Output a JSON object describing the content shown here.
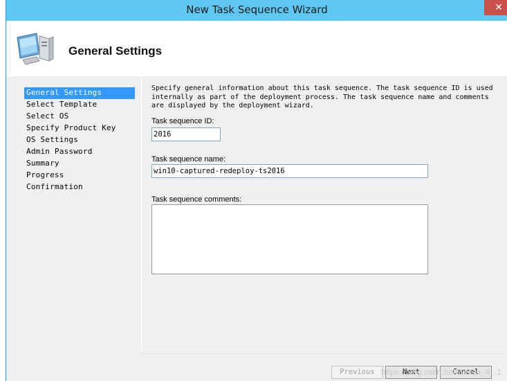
{
  "window": {
    "title": "New Task Sequence Wizard",
    "close_glyph": "✕"
  },
  "header": {
    "title": "General Settings",
    "icon": "computer-icon"
  },
  "nav": {
    "items": [
      {
        "label": "General Settings"
      },
      {
        "label": "Select Template"
      },
      {
        "label": "Select OS"
      },
      {
        "label": "Specify Product Key"
      },
      {
        "label": "OS Settings"
      },
      {
        "label": "Admin Password"
      },
      {
        "label": "Summary"
      },
      {
        "label": "Progress"
      },
      {
        "label": "Confirmation"
      }
    ],
    "selected_index": 0
  },
  "form": {
    "description": "Specify general information about this task sequence.  The task sequence ID is used internally as part of the deployment process.  The task sequence name and comments are displayed by the deployment wizard.",
    "id_label": "Task sequence ID:",
    "id_value": "2016",
    "name_label": "Task sequence name:",
    "name_value": "win10-captured-redeploy-ts2016",
    "comments_label": "Task sequence comments:",
    "comments_value": ""
  },
  "buttons": {
    "previous": "Previous",
    "next": "Next",
    "cancel": "Cancel"
  },
  "watermark": "https://blog.csdn.net/weixin_4...1"
}
